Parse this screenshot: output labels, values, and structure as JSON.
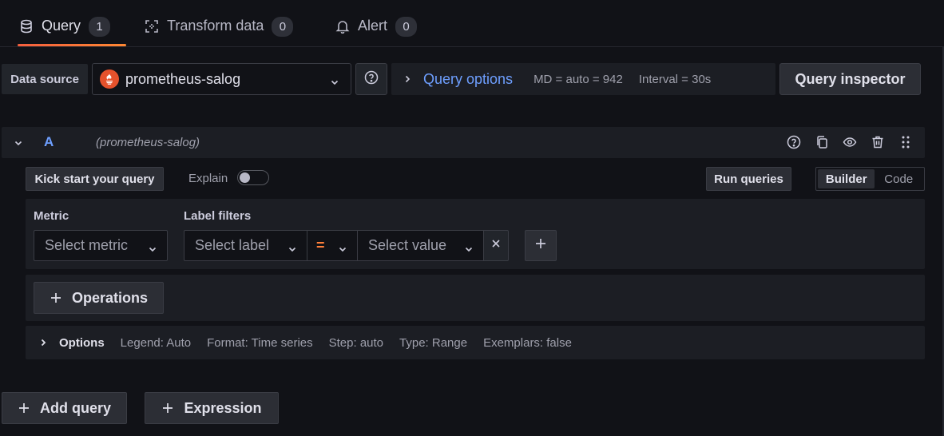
{
  "tabs": [
    {
      "label": "Query",
      "count": "1",
      "icon": "database-icon"
    },
    {
      "label": "Transform data",
      "count": "0",
      "icon": "transform-icon"
    },
    {
      "label": "Alert",
      "count": "0",
      "icon": "bell-icon"
    }
  ],
  "toolbar": {
    "datasource_label": "Data source",
    "datasource_value": "prometheus-salog",
    "query_options_title": "Query options",
    "md_text": "MD = auto = 942",
    "interval_text": "Interval = 30s",
    "query_inspector_label": "Query inspector"
  },
  "query": {
    "ref_id": "A",
    "datasource_name": "(prometheus-salog)",
    "kick_start_label": "Kick start your query",
    "explain_label": "Explain",
    "run_queries_label": "Run queries",
    "mode_builder": "Builder",
    "mode_code": "Code",
    "metric_label": "Metric",
    "label_filters_label": "Label filters",
    "metric_placeholder": "Select metric",
    "label_placeholder": "Select label",
    "operator": "=",
    "value_placeholder": "Select value",
    "operations_label": "Operations",
    "options_title": "Options",
    "options_meta": [
      "Legend: Auto",
      "Format: Time series",
      "Step: auto",
      "Type: Range",
      "Exemplars: false"
    ]
  },
  "footer": {
    "add_query_label": "Add query",
    "expression_label": "Expression"
  },
  "colors": {
    "accent_blue": "#6e9fff",
    "tab_underline": "#f55f3e",
    "operator_orange": "#ff7f3a",
    "prometheus_red": "#e6522c"
  }
}
